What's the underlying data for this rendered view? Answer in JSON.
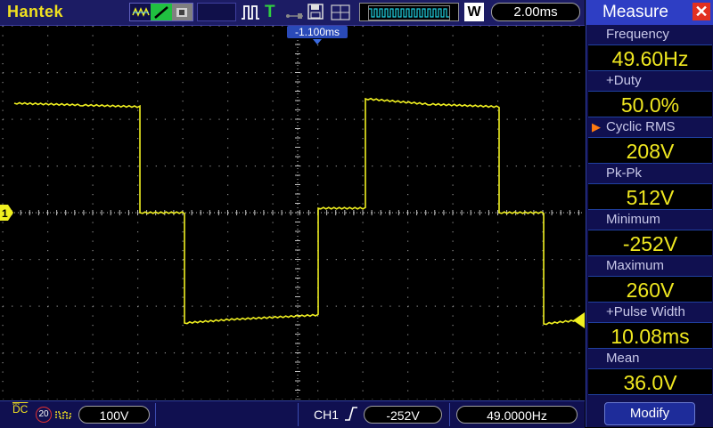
{
  "brand": "Hantek",
  "toolbar": {
    "mode_icons": [
      "waveform-mode-icon",
      "line-mode-icon",
      "persist-mode-icon"
    ],
    "timebase": "2.00ms",
    "w_label": "W"
  },
  "trigger": {
    "horizontal_position": "-1.100ms"
  },
  "measure_panel": {
    "title": "Measure",
    "items": [
      {
        "label": "Frequency",
        "value": "49.60Hz"
      },
      {
        "label": "+Duty",
        "value": "50.0%"
      },
      {
        "label": "Cyclic RMS",
        "value": "208V",
        "selected": true
      },
      {
        "label": "Pk-Pk",
        "value": "512V"
      },
      {
        "label": "Minimum",
        "value": "-252V"
      },
      {
        "label": "Maximum",
        "value": "260V"
      },
      {
        "label": "+Pulse Width",
        "value": "10.08ms"
      },
      {
        "label": "Mean",
        "value": "36.0V"
      }
    ],
    "modify_label": "Modify"
  },
  "bottom": {
    "coupling": "DC",
    "bw_limit": "20",
    "volts_div": "100V",
    "trigger_source": "CH1",
    "trigger_level": "-252V",
    "trigger_freq": "49.0000Hz"
  },
  "channel_marker": "1",
  "colors": {
    "trace": "#f0f020",
    "panel_bg": "#101050",
    "header": "#2e3ec4",
    "value": "#f0e820",
    "close": "#e23020"
  }
}
